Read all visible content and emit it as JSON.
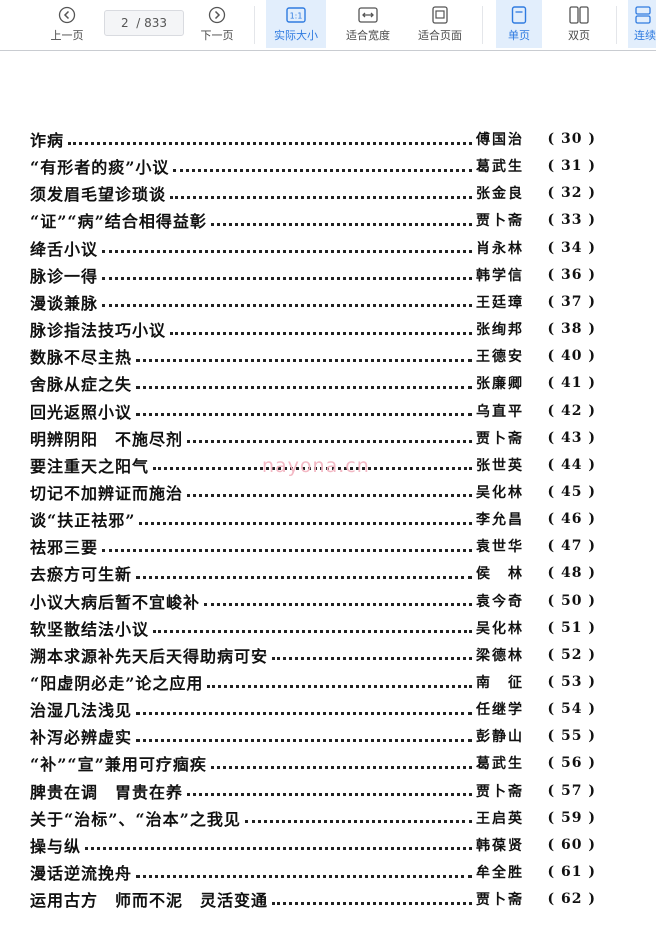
{
  "toolbar": {
    "prev_label": "上一页",
    "next_label": "下一页",
    "page_current": "2",
    "page_total": "/ 833",
    "actual_size_label": "实际大小",
    "fit_width_label": "适合宽度",
    "fit_page_label": "适合页面",
    "single_page_label": "单页",
    "double_page_label": "双页",
    "continuous_label": "连续"
  },
  "watermark": "nayona.cn",
  "toc": [
    {
      "title": "诈病",
      "author": "傅国治",
      "page": "( 30 )"
    },
    {
      "title": "“有形者的痰”小议",
      "author": "葛武生",
      "page": "( 31 )"
    },
    {
      "title": "须发眉毛望诊琐谈",
      "author": "张金良",
      "page": "( 32 )"
    },
    {
      "title": "“证”“病”结合相得益彰",
      "author": "贾卜斋",
      "page": "( 33 )"
    },
    {
      "title": "绛舌小议",
      "author": "肖永林",
      "page": "( 34 )"
    },
    {
      "title": "脉诊一得",
      "author": "韩学信",
      "page": "( 36 )"
    },
    {
      "title": "漫谈兼脉",
      "author": "王廷璋",
      "page": "( 37 )"
    },
    {
      "title": "脉诊指法技巧小议",
      "author": "张绚邦",
      "page": "( 38 )"
    },
    {
      "title": "数脉不尽主热",
      "author": "王德安",
      "page": "( 40 )"
    },
    {
      "title": "舍脉从症之失",
      "author": "张廉卿",
      "page": "( 41 )"
    },
    {
      "title": "回光返照小议",
      "author": "乌直平",
      "page": "( 42 )"
    },
    {
      "title": "明辨阴阳　不施尽剂",
      "author": "贾卜斋",
      "page": "( 43 )"
    },
    {
      "title": "要注重天之阳气",
      "author": "张世英",
      "page": "( 44 )"
    },
    {
      "title": "切记不加辨证而施治",
      "author": "吴化林",
      "page": "( 45 )"
    },
    {
      "title": "谈“扶正祛邪”",
      "author": "李允昌",
      "page": "( 46 )"
    },
    {
      "title": "祛邪三要",
      "author": "袁世华",
      "page": "( 47 )"
    },
    {
      "title": "去瘀方可生新",
      "author": "侯　林",
      "page": "( 48 )"
    },
    {
      "title": "小议大病后暂不宜峻补",
      "author": "袁今奇",
      "page": "( 50 )"
    },
    {
      "title": "软坚散结法小议",
      "author": "吴化林",
      "page": "( 51 )"
    },
    {
      "title": "溯本求源补先天后天得助病可安",
      "author": "梁德林",
      "page": "( 52 )"
    },
    {
      "title": "“阳虚阴必走”论之应用",
      "author": "南　征",
      "page": "( 53 )"
    },
    {
      "title": "治湿几法浅见",
      "author": "任继学",
      "page": "( 54 )"
    },
    {
      "title": "补泻必辨虚实",
      "author": "彭静山",
      "page": "( 55 )"
    },
    {
      "title": "“补”“宣”兼用可疗痼疾",
      "author": "葛武生",
      "page": "( 56 )"
    },
    {
      "title": "脾贵在调　胃贵在养",
      "author": "贾卜斋",
      "page": "( 57 )"
    },
    {
      "title": "关于“治标”、“治本”之我见",
      "author": "王启英",
      "page": "( 59 )"
    },
    {
      "title": "操与纵",
      "author": "韩葆贤",
      "page": "( 60 )"
    },
    {
      "title": "漫话逆流挽舟",
      "author": "牟全胜",
      "page": "( 61 )"
    },
    {
      "title": "运用古方　师而不泥　灵活变通",
      "author": "贾卜斋",
      "page": "( 62 )"
    }
  ]
}
